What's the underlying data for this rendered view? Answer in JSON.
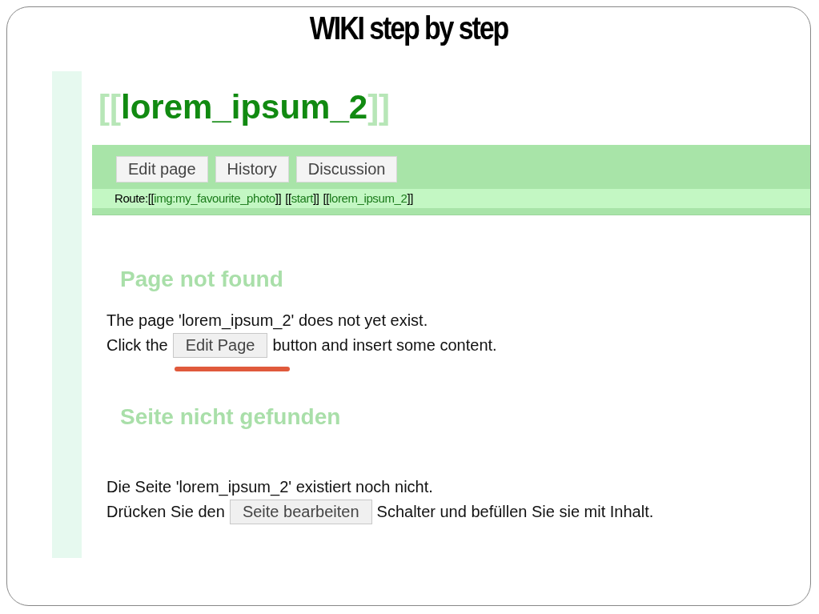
{
  "slide": {
    "title": "WIKI step by step"
  },
  "page": {
    "title_open": "[[",
    "title": "lorem_ipsum_2",
    "title_close": "]]",
    "actions": [
      {
        "label": "Edit page"
      },
      {
        "label": "History"
      },
      {
        "label": "Discussion"
      }
    ],
    "route": {
      "label": "Route:",
      "links": [
        {
          "open": "[[",
          "link": "img:my_favourite_photo",
          "close": "]]"
        },
        {
          "open": "[[",
          "link": "start",
          "close": "]]"
        },
        {
          "open": "[[",
          "link": "lorem_ipsum_2",
          "close": "]]"
        }
      ]
    }
  },
  "sections": [
    {
      "heading": "Page not found",
      "line_1": "The page 'lorem_ipsum_2' does not yet exist.",
      "before": "Click the",
      "button": "Edit Page",
      "after": "button and insert some content.",
      "underlined": true
    },
    {
      "heading": "Seite nicht gefunden",
      "line_1": "Die Seite 'lorem_ipsum_2' existiert noch nicht.",
      "before": "Drücken Sie den",
      "button": "Seite bearbeiten",
      "after": "Schalter und befüllen Sie sie mit Inhalt.",
      "underlined": false
    }
  ]
}
